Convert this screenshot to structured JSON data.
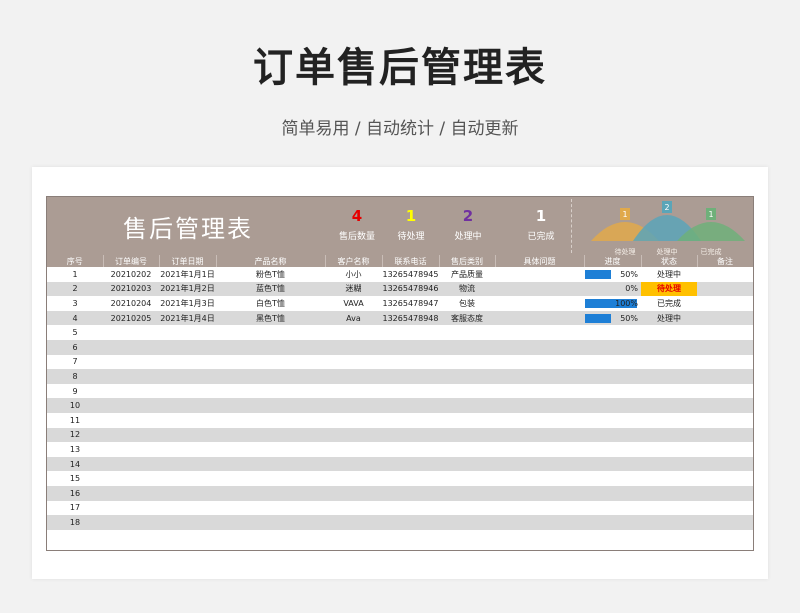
{
  "hero": {
    "title": "订单售后管理表",
    "subtitle": "简单易用 / 自动统计 / 自动更新"
  },
  "banner": {
    "title": "售后管理表",
    "stats": [
      {
        "value": "4",
        "label": "售后数量",
        "color": "#e60000"
      },
      {
        "value": "1",
        "label": "待处理",
        "color": "#ffff00"
      },
      {
        "value": "2",
        "label": "处理中",
        "color": "#7030a0"
      },
      {
        "value": "1",
        "label": "已完成",
        "color": "#ffffff"
      }
    ],
    "mini_chart": {
      "values": [
        1,
        2,
        1
      ],
      "labels": [
        "待处理",
        "处理中",
        "已完成"
      ],
      "colors": [
        "#e0a94b",
        "#5aa5b8",
        "#6fb07a"
      ]
    }
  },
  "table": {
    "columns": [
      "序号",
      "订单编号",
      "订单日期",
      "产品名称",
      "客户名称",
      "联系电话",
      "售后类别",
      "具体问题",
      "进度",
      "状态",
      "备注"
    ],
    "rows": [
      {
        "no": "1",
        "order": "20210202",
        "date": "2021年1月1日",
        "product": "粉色T恤",
        "customer": "小小",
        "phone": "13265478945",
        "category": "产品质量",
        "issue": "",
        "progress": 0.5,
        "progress_text": "50%",
        "status": "处理中",
        "status_warn": false,
        "note": ""
      },
      {
        "no": "2",
        "order": "20210203",
        "date": "2021年1月2日",
        "product": "蓝色T恤",
        "customer": "迷糊",
        "phone": "13265478946",
        "category": "物流",
        "issue": "",
        "progress": 0,
        "progress_text": "0%",
        "status": "待处理",
        "status_warn": true,
        "note": ""
      },
      {
        "no": "3",
        "order": "20210204",
        "date": "2021年1月3日",
        "product": "白色T恤",
        "customer": "VAVA",
        "phone": "13265478947",
        "category": "包装",
        "issue": "",
        "progress": 1,
        "progress_text": "100%",
        "status": "已完成",
        "status_warn": false,
        "note": ""
      },
      {
        "no": "4",
        "order": "20210205",
        "date": "2021年1月4日",
        "product": "黑色T恤",
        "customer": "Ava",
        "phone": "13265478948",
        "category": "客服态度",
        "issue": "",
        "progress": 0.5,
        "progress_text": "50%",
        "status": "处理中",
        "status_warn": false,
        "note": ""
      },
      {
        "no": "5"
      },
      {
        "no": "6"
      },
      {
        "no": "7"
      },
      {
        "no": "8"
      },
      {
        "no": "9"
      },
      {
        "no": "10"
      },
      {
        "no": "11"
      },
      {
        "no": "12"
      },
      {
        "no": "13"
      },
      {
        "no": "14"
      },
      {
        "no": "15"
      },
      {
        "no": "16"
      },
      {
        "no": "17"
      },
      {
        "no": "18"
      }
    ]
  }
}
